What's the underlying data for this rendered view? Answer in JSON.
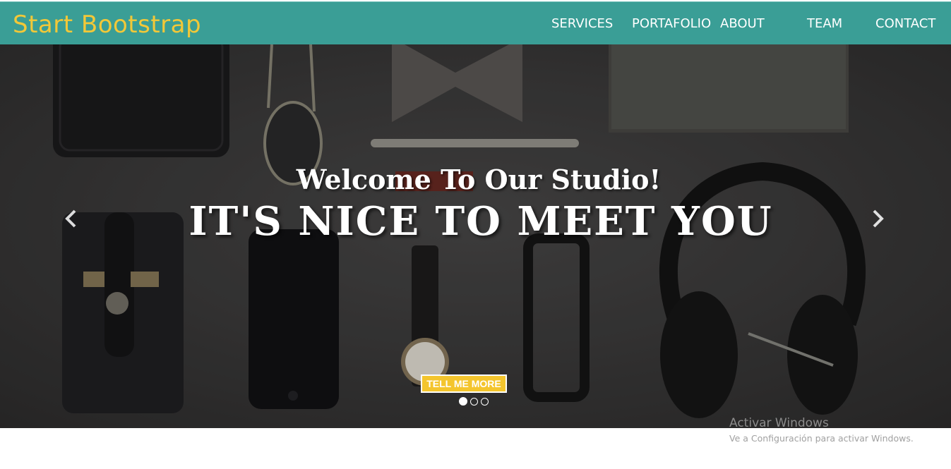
{
  "navbar": {
    "brand": "Start Bootstrap",
    "items": [
      {
        "label": "SERVICES"
      },
      {
        "label": "PORTAFOLIO"
      },
      {
        "label": "ABOUT"
      },
      {
        "label": "TEAM"
      },
      {
        "label": "CONTACT"
      }
    ],
    "background_color": "#3a9e96",
    "brand_color": "#f2c838"
  },
  "hero": {
    "subheading": "Welcome To Our Studio!",
    "heading": "IT'S NICE TO MEET YOU",
    "cta_label": "TELL ME MORE",
    "cta_color": "#f4c52d",
    "prev_icon": "chevron-left-icon",
    "next_icon": "chevron-right-icon",
    "indicators_count": 3,
    "active_indicator": 1
  },
  "watermark": {
    "title": "Activar Windows",
    "subtitle": "Ve a Configuración para activar Windows."
  }
}
